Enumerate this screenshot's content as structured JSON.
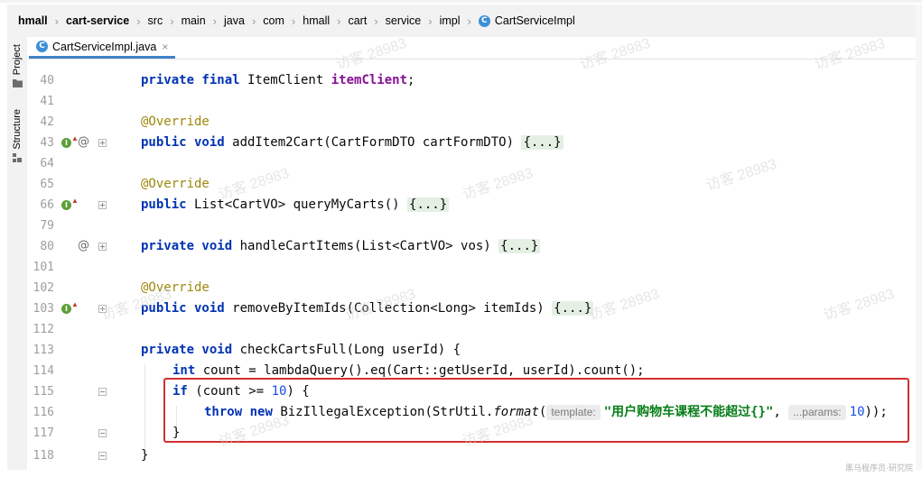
{
  "breadcrumb": [
    "hmall",
    "cart-service",
    "src",
    "main",
    "java",
    "com",
    "hmall",
    "cart",
    "service",
    "impl"
  ],
  "breadcrumb_file": "CartServiceImpl",
  "sidebar": {
    "project_label": "Project",
    "structure_label": "Structure"
  },
  "tab": {
    "label": "CartServiceImpl.java",
    "close": "×"
  },
  "watermark_text": "访客 28983",
  "corner_mark": "黑马程序员·研究院",
  "lines": [
    {
      "n": "40"
    },
    {
      "n": "41"
    },
    {
      "n": "42"
    },
    {
      "n": "43"
    },
    {
      "n": "64"
    },
    {
      "n": "65"
    },
    {
      "n": "66"
    },
    {
      "n": "79"
    },
    {
      "n": "80"
    },
    {
      "n": "101"
    },
    {
      "n": "102"
    },
    {
      "n": "103"
    },
    {
      "n": "112"
    },
    {
      "n": "113"
    },
    {
      "n": "114"
    },
    {
      "n": "115"
    },
    {
      "n": "116"
    },
    {
      "n": "117"
    },
    {
      "n": "118"
    }
  ],
  "code": {
    "l40": {
      "kw": "private final",
      "type": " ItemClient ",
      "field": "itemClient",
      "end": ";"
    },
    "l42": "@Override",
    "l43": {
      "kw": "public void",
      "rest": " addItem2Cart(CartFormDTO cartFormDTO) ",
      "fold": "{...}"
    },
    "l65": "@Override",
    "l66": {
      "kw": "public",
      "rest": " List<CartVO> queryMyCarts() ",
      "fold": "{...}"
    },
    "l80": {
      "kw": "private void",
      "rest": " handleCartItems(List<CartVO> vos) ",
      "fold": "{...}"
    },
    "l102": "@Override",
    "l103": {
      "kw": "public void",
      "rest": " removeByItemIds(Collection<Long> itemIds) ",
      "fold": "{...}"
    },
    "l113": {
      "kw": "private void",
      "rest": " checkCartsFull(Long userId) {"
    },
    "l114": {
      "kw": "int",
      "rest": " count = lambdaQuery().eq(Cart::getUserId, userId).count();"
    },
    "l115": {
      "kw": "if",
      "pre": " (count >= ",
      "num": "10",
      "post": ") {"
    },
    "l116": {
      "kw1": "throw",
      "kw2": "new",
      "pre": " BizIllegalException(StrUtil.",
      "method": "format",
      "open": "(",
      "hint1": "template:",
      "str": "\"用户购物车课程不能超过{}\"",
      "comma": ", ",
      "hint2": "...params:",
      "num": "10",
      "close": "));"
    },
    "l117": "}",
    "l118": "}"
  }
}
